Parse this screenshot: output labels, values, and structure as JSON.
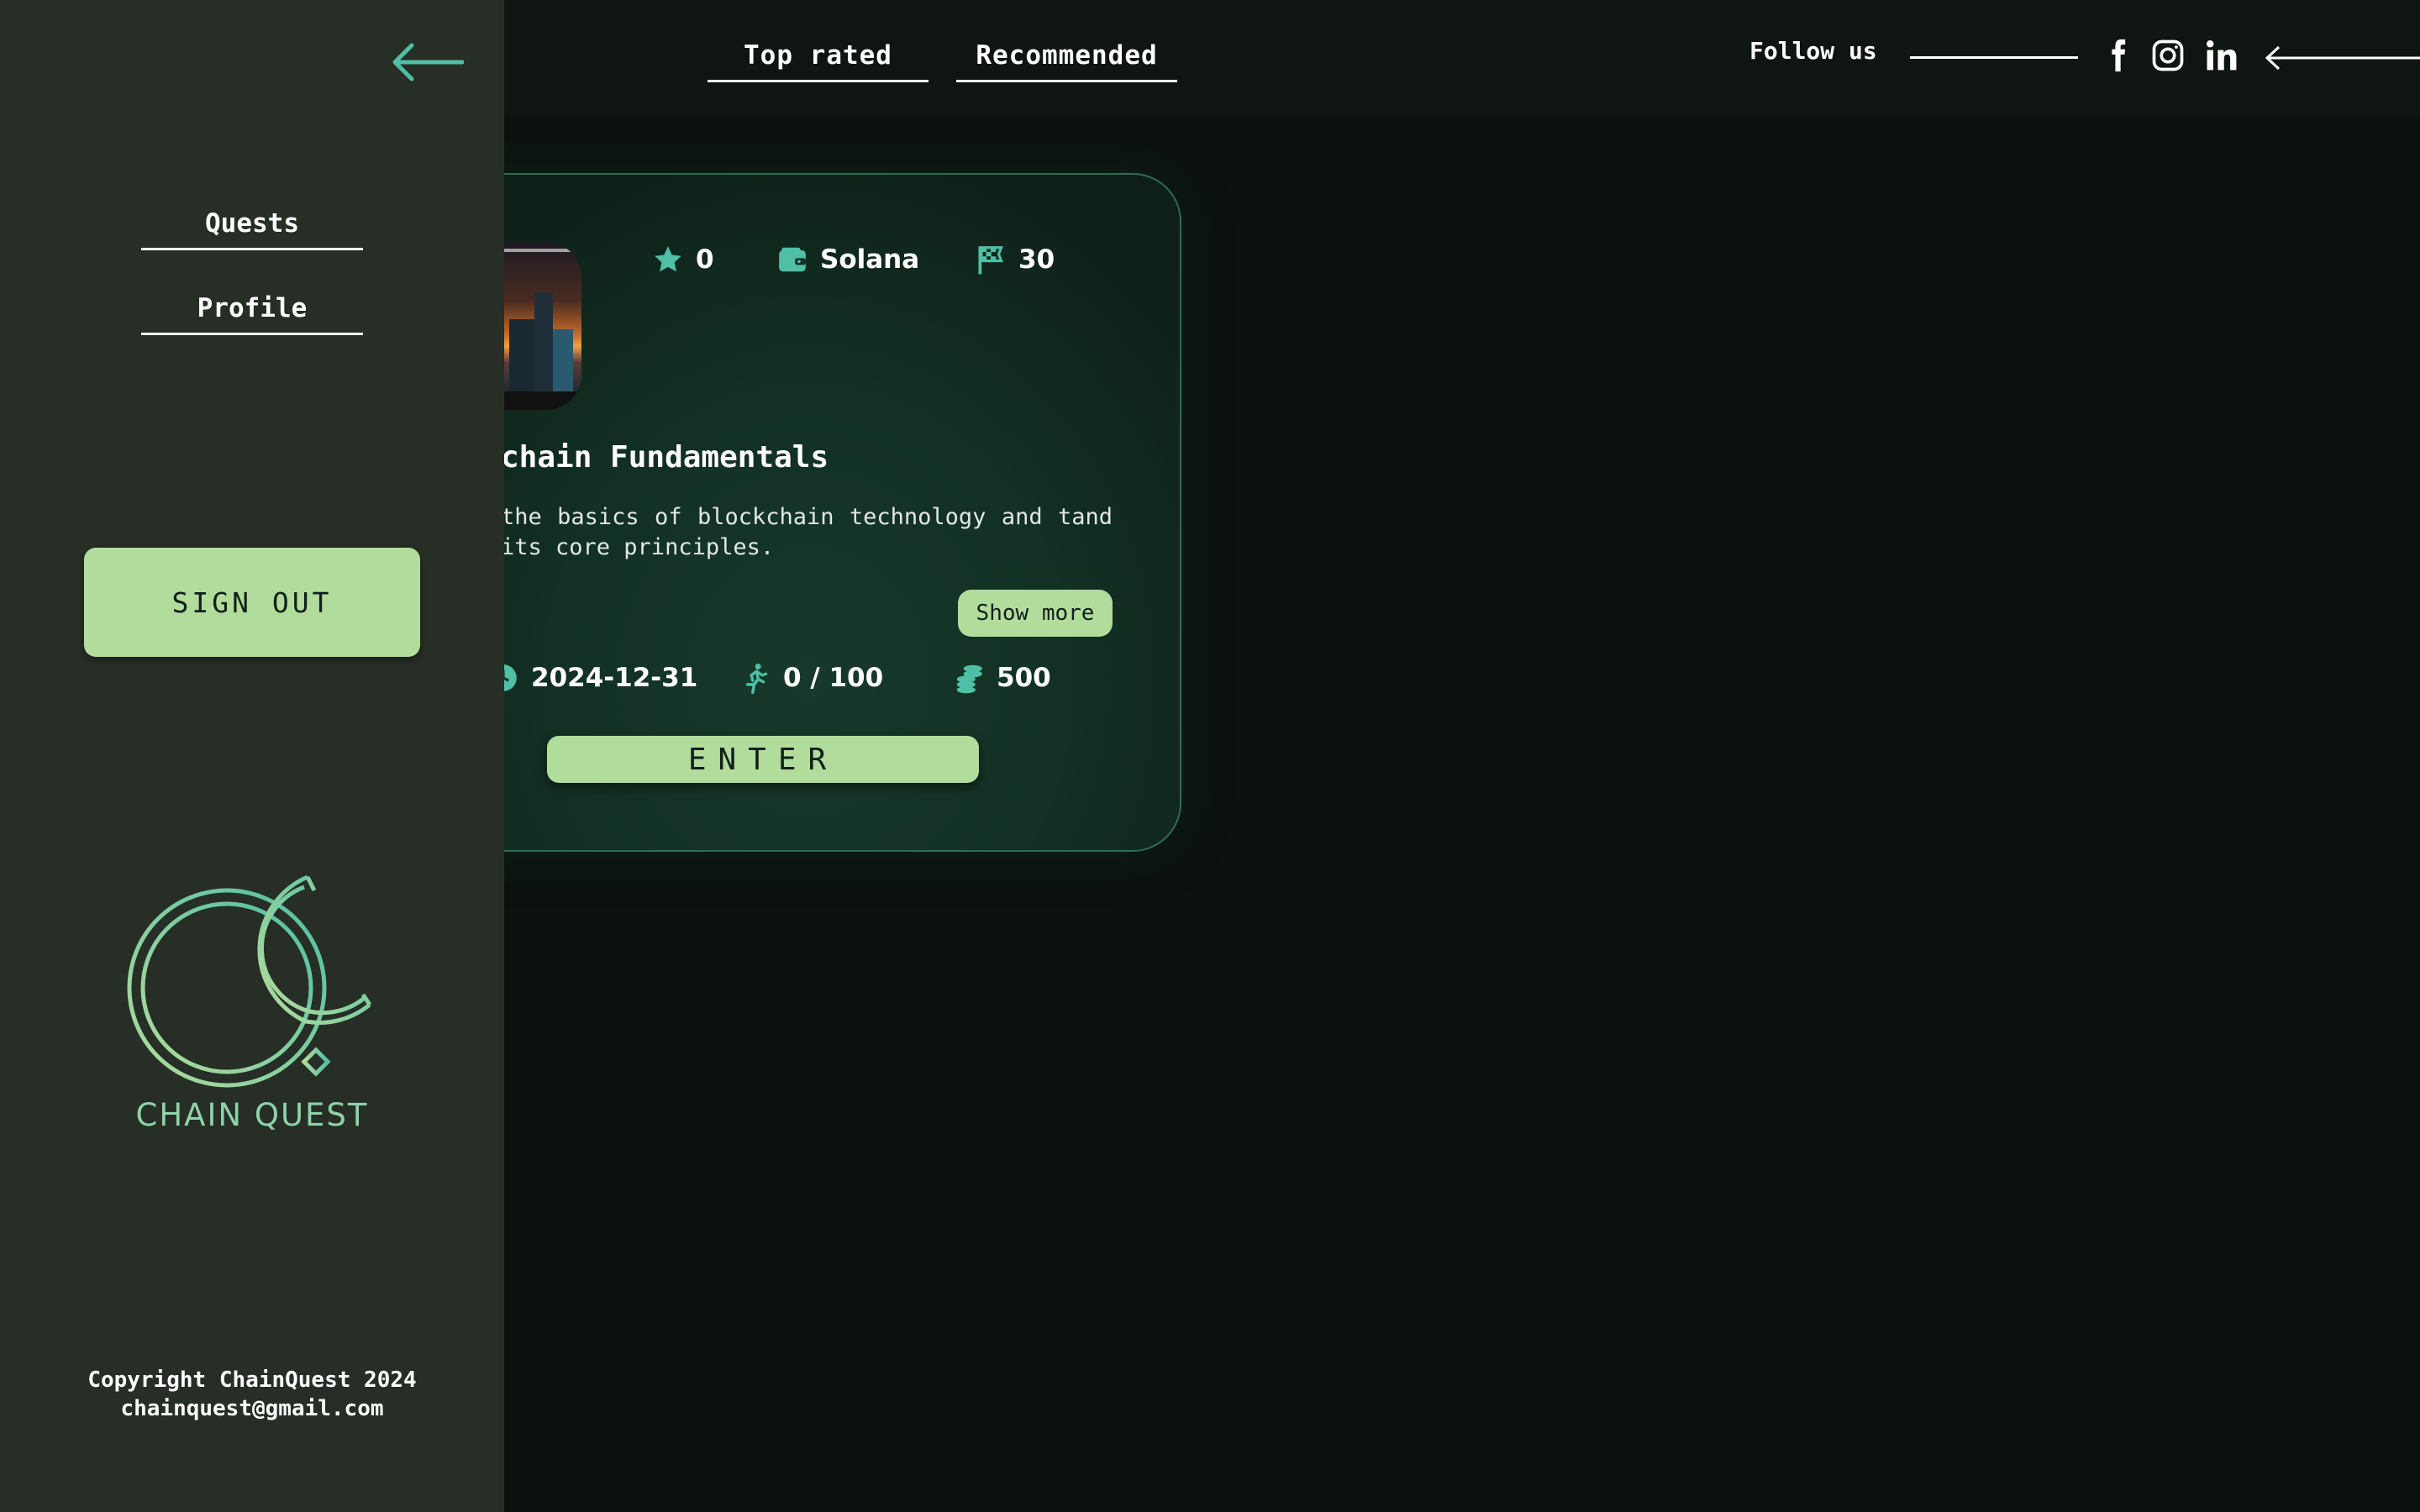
{
  "header": {
    "tabs": [
      {
        "label": "Top rated"
      },
      {
        "label": "Recommended"
      }
    ],
    "follow_label": "Follow us",
    "social_icons": [
      "facebook-icon",
      "instagram-icon",
      "linkedin-icon"
    ]
  },
  "sidebar": {
    "nav": [
      {
        "label": "Quests"
      },
      {
        "label": "Profile"
      }
    ],
    "sign_out_label": "SIGN OUT",
    "brand_name": "CHAIN QUEST",
    "copyright": "Copyright ChainQuest 2024",
    "email": "chainquest@gmail.com"
  },
  "quest_card": {
    "rating": "0",
    "chain": "Solana",
    "steps": "30",
    "title": "chain Fundamentals",
    "description": "the basics of blockchain technology and tand its core principles.",
    "show_more_label": "Show more",
    "end_date": "2024-12-31",
    "participants": "0 / 100",
    "reward": "500",
    "enter_label": "ENTER"
  },
  "colors": {
    "accent": "#4fbfa5",
    "button": "#b2dc9c",
    "sidebar_bg": "#262e26",
    "page_bg": "#0c120e",
    "card_border": "#2f6b55"
  }
}
